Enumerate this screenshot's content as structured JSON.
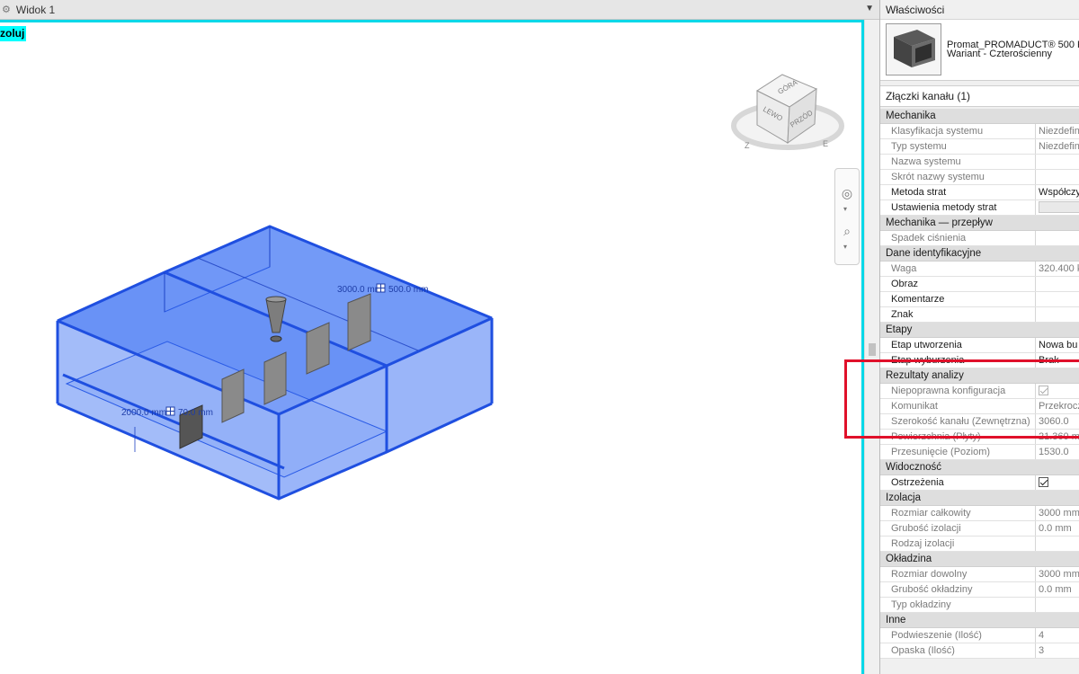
{
  "view": {
    "title": "Widok 1",
    "isolate_label": "zoluj",
    "dim_top": "3000.0 mm",
    "dim_top_right": "500.0 mm",
    "dim_left": "2000.0 mm",
    "dim_left_right": "70.0 mm",
    "viewcube": {
      "top": "GÓRA",
      "left": "LEWO",
      "front": "PRZÓD"
    }
  },
  "properties": {
    "title": "Właściwości",
    "type_name": "Promat_PROMADUCT® 500 K",
    "type_variant": "Wariant - Czterościenny",
    "filter": "Złączki kanału (1)",
    "groups": [
      {
        "name": "Mechanika",
        "rows": [
          {
            "k": "Klasyfikacja systemu",
            "v": "Niezdefin",
            "ro": true
          },
          {
            "k": "Typ systemu",
            "v": "Niezdefin",
            "ro": true
          },
          {
            "k": "Nazwa systemu",
            "v": "",
            "ro": true
          },
          {
            "k": "Skrót nazwy systemu",
            "v": "",
            "ro": true
          },
          {
            "k": "Metoda strat",
            "v": "Współczy",
            "ro": false
          },
          {
            "k": "Ustawienia metody strat",
            "v": "",
            "ro": false,
            "button": true
          }
        ]
      },
      {
        "name": "Mechanika — przepływ",
        "rows": [
          {
            "k": "Spadek ciśnienia",
            "v": "",
            "ro": true
          }
        ]
      },
      {
        "name": "Dane identyfikacyjne",
        "rows": [
          {
            "k": "Waga",
            "v": "320.400 k",
            "ro": true
          },
          {
            "k": "Obraz",
            "v": "",
            "ro": false
          },
          {
            "k": "Komentarze",
            "v": "",
            "ro": false
          },
          {
            "k": "Znak",
            "v": "",
            "ro": false
          }
        ]
      },
      {
        "name": "Etapy",
        "rows": [
          {
            "k": "Etap utworzenia",
            "v": "Nowa bu",
            "ro": false
          },
          {
            "k": "Etap wyburzenia",
            "v": "Brak",
            "ro": false
          }
        ]
      },
      {
        "name": "Rezultaty analizy",
        "rows": [
          {
            "k": "Niepoprawna konfiguracja",
            "v": "",
            "ro": true,
            "check": "disabled"
          },
          {
            "k": "Komunikat",
            "v": "Przekrocz",
            "ro": true
          },
          {
            "k": "Szerokość kanału (Zewnętrzna)",
            "v": "3060.0",
            "ro": true
          },
          {
            "k": "Powierzchnia (Płyty)",
            "v": "21.360 m²",
            "ro": true
          },
          {
            "k": "Przesunięcie (Poziom)",
            "v": "1530.0",
            "ro": true
          }
        ]
      },
      {
        "name": "Widoczność",
        "rows": [
          {
            "k": "Ostrzeżenia",
            "v": "",
            "ro": false,
            "check": "enabled"
          }
        ]
      },
      {
        "name": "Izolacja",
        "rows": [
          {
            "k": "Rozmiar całkowity",
            "v": "3000 mm",
            "ro": true
          },
          {
            "k": "Grubość izolacji",
            "v": "0.0 mm",
            "ro": true
          },
          {
            "k": "Rodzaj izolacji",
            "v": "",
            "ro": true
          }
        ]
      },
      {
        "name": "Okładzina",
        "rows": [
          {
            "k": "Rozmiar dowolny",
            "v": "3000 mm",
            "ro": true
          },
          {
            "k": "Grubość okładziny",
            "v": "0.0 mm",
            "ro": true
          },
          {
            "k": "Typ okładziny",
            "v": "",
            "ro": true
          }
        ]
      },
      {
        "name": "Inne",
        "rows": [
          {
            "k": "Podwieszenie (Ilość)",
            "v": "4",
            "ro": true
          },
          {
            "k": "Opaska (Ilość)",
            "v": "3",
            "ro": true
          }
        ]
      }
    ]
  },
  "colors": {
    "accent_cyan": "#00d8e8",
    "highlight_red": "#e0102a",
    "duct_blue": "#2f64f5"
  }
}
